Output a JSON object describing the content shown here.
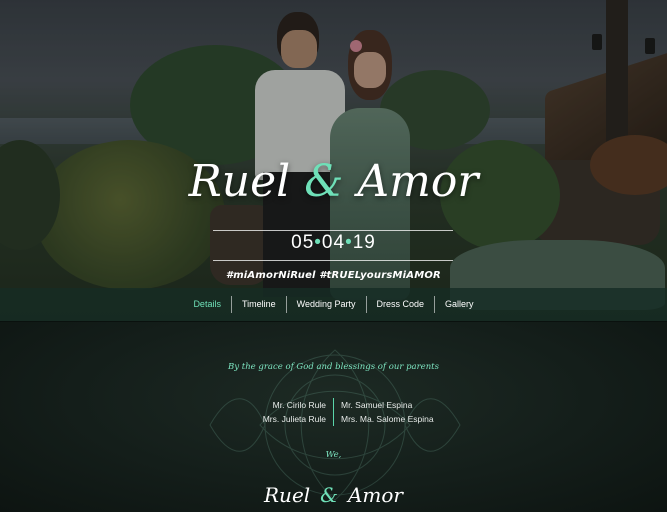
{
  "hero": {
    "bride_groom_left": "Ruel",
    "ampersand": "&",
    "bride_groom_right": "Amor",
    "date_part1": "05",
    "date_sep": "•",
    "date_part2": "04",
    "date_part3": "19",
    "hashtags": "#miAmorNiRuel #tRUELyoursMiAMOR"
  },
  "nav": {
    "items": [
      {
        "label": "Details"
      },
      {
        "label": "Timeline"
      },
      {
        "label": "Wedding Party"
      },
      {
        "label": "Dress Code"
      },
      {
        "label": "Gallery"
      }
    ],
    "active_index": 0
  },
  "details": {
    "grace_line": "By the grace of God and blessings of our parents",
    "parents_left": [
      "Mr. Cirilo Rule",
      "Mrs. Julieta Rule"
    ],
    "parents_right": [
      "Mr. Samuel Espina",
      "Mrs. Ma. Salome Espina"
    ],
    "we_line": "We,",
    "names_left": "Ruel",
    "names_amp": "&",
    "names_right": "Amor"
  },
  "colors": {
    "accent": "#6fe0b8",
    "nav_bg": "#162c24",
    "content_bg": "#141e1a"
  }
}
